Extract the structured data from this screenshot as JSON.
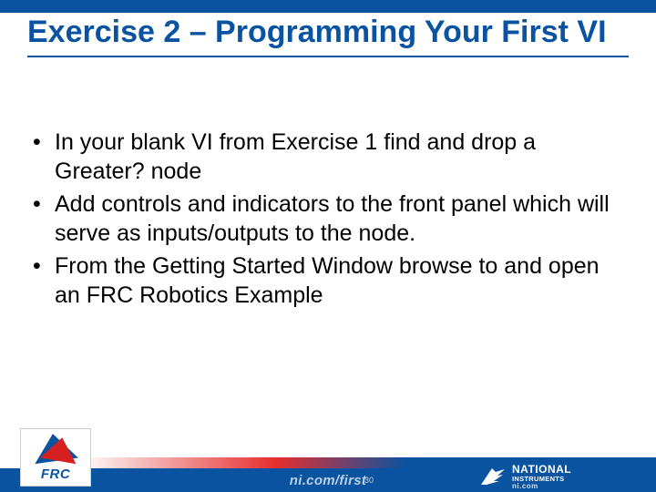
{
  "title": "Exercise 2 – Programming Your First VI",
  "bullets": [
    "In your blank VI from Exercise 1 find and drop a Greater? node",
    "Add controls and indicators to the front panel which will serve as inputs/outputs to the node.",
    "From the Getting Started Window browse to and open an FRC Robotics Example"
  ],
  "footer": {
    "url": "ni.com/first",
    "page": "30"
  },
  "logos": {
    "frc": "FRC",
    "ni": {
      "line1": "NATIONAL",
      "line2": "INSTRUMENTS",
      "line3": "ni.com"
    }
  }
}
